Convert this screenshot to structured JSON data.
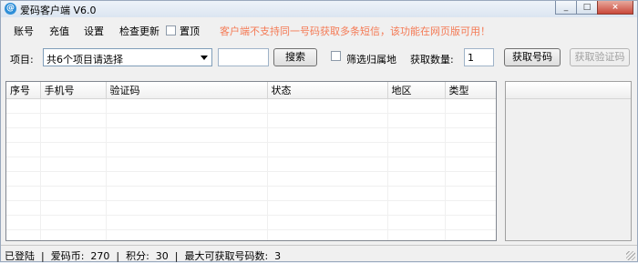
{
  "window": {
    "title": "爱码客户端 V6.0",
    "app_icon_glyph": "@",
    "controls": {
      "minimize": "_",
      "maximize": "□",
      "close": "×"
    }
  },
  "menu": {
    "items": [
      "账号",
      "充值",
      "设置",
      "检查更新"
    ],
    "pin_label": "置顶",
    "pin_checked": false,
    "notice": "客户端不支持同一号码获取多条短信，该功能在网页版可用！"
  },
  "toolbar": {
    "project_label": "项目:",
    "project_value": "共6个项目请选择",
    "search_value": "",
    "search_button": "搜索",
    "filter_label": "筛选归属地",
    "filter_checked": false,
    "qty_label": "获取数量:",
    "qty_value": "1",
    "get_number_button": "获取号码",
    "get_code_button": "获取验证码"
  },
  "grid": {
    "columns": [
      "序号",
      "手机号",
      "验证码",
      "状态",
      "地区",
      "类型"
    ],
    "rows": []
  },
  "status": {
    "text": "已登陆  |  爱码币:  270  |  积分:  30  |  最大可获取号码数:  3"
  },
  "colors": {
    "notice": "#f47a55",
    "window_bg": "#f0f0f0"
  }
}
